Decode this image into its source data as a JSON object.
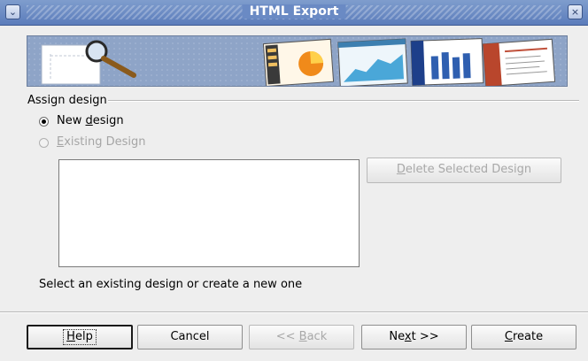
{
  "window": {
    "title": "HTML Export",
    "menu_icon": "chevron-down-icon",
    "close_icon": "close-icon",
    "close_glyph": "×",
    "menu_glyph": "⌄"
  },
  "banner": {
    "icons": [
      "magnifier-icon",
      "pie-chart-icon",
      "area-chart-icon",
      "bar-chart-icon",
      "document-icon"
    ]
  },
  "assign_design": {
    "label": "Assign design",
    "new_design": {
      "label_pre": "New ",
      "label_key": "d",
      "label_post": "esign",
      "checked": true,
      "enabled": true
    },
    "existing_design": {
      "label_pre": "",
      "label_key": "E",
      "label_post": "xisting Design",
      "checked": false,
      "enabled": false
    },
    "design_list_items": [],
    "delete_button": {
      "label_pre": "",
      "label_key": "D",
      "label_post": "elete Selected Design",
      "enabled": false
    }
  },
  "hint_text": "Select an existing design or create a new one",
  "footer": {
    "help": {
      "label_pre": "",
      "label_key": "H",
      "label_post": "elp"
    },
    "cancel": {
      "label": "Cancel"
    },
    "back": {
      "label_pre": "<< ",
      "label_key": "B",
      "label_post": "ack",
      "enabled": false
    },
    "next": {
      "label_pre": "Ne",
      "label_key": "x",
      "label_post": "t >>"
    },
    "create": {
      "label_pre": "",
      "label_key": "C",
      "label_post": "reate"
    }
  },
  "colors": {
    "titlebar": "#6a8ac4",
    "banner_bg": "#8ea4c7",
    "disabled_text": "#a5a5a5"
  }
}
